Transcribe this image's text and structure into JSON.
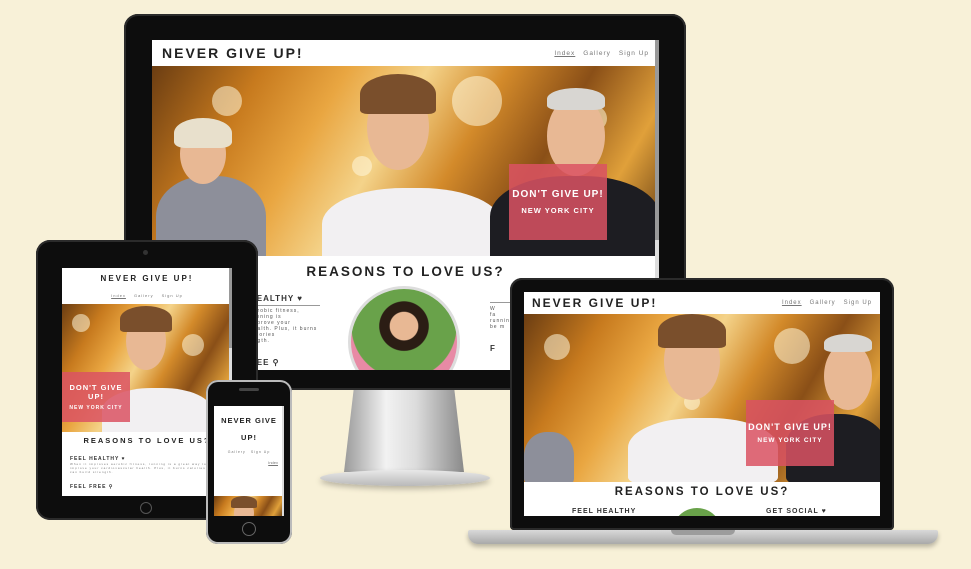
{
  "site": {
    "brand": "NEVER GIVE UP!",
    "brand_line1": "NEVER GIVE",
    "brand_line2": "UP!",
    "nav": [
      "Index",
      "Gallery",
      "Sign Up"
    ],
    "badge_title": "DON'T GIVE UP!",
    "badge_sub": "NEW YORK CITY",
    "reasons": "REASONS TO LOVE US?",
    "feature_healthy": "FEEL HEALTHY",
    "feature_free": "FEEL FREE",
    "feature_social": "GET SOCIAL",
    "healthy_text": "aerobic fitness, running is ... improve your ... health. Plus, it burns calories ... ength.",
    "healthy_text_tablet": "When it improves aerobic fitness, running is a great way to help improve your cardiovascular health. Plus, it burns calories and can build strength."
  },
  "colors": {
    "background": "#f8f1d8",
    "badge": "#db5263",
    "bezel": "#0d0d0d"
  }
}
